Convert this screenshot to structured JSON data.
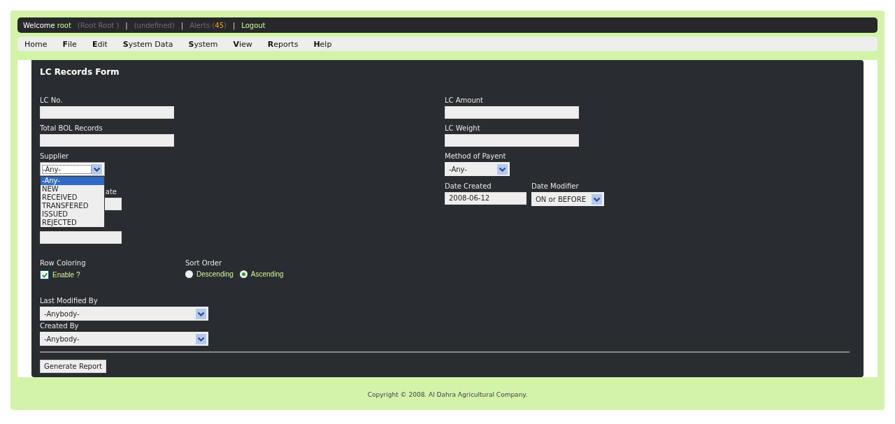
{
  "top_bar": [
    {
      "kind": "plain",
      "text": "Welcome"
    },
    {
      "kind": "user",
      "text": "root"
    },
    {
      "kind": "muted",
      "text": "(Root Root )"
    },
    {
      "kind": "sep",
      "text": "|"
    },
    {
      "kind": "muted",
      "text": "(undefined)"
    },
    {
      "kind": "sep",
      "text": "|"
    },
    {
      "kind": "alerts",
      "label": "Alerts (",
      "count": "45",
      "close": ")"
    },
    {
      "kind": "sep",
      "text": "|"
    },
    {
      "kind": "link",
      "text": "Logout"
    }
  ],
  "menu": [
    "Home",
    "**F**ile",
    "**E**dit",
    "**S**ystem Data",
    "**S**ystem",
    "**V**iew",
    "**R**eports",
    "**H**elp"
  ],
  "form": {
    "title": "LC Records Form",
    "left": [
      {
        "kind": "text",
        "label": "LC No."
      },
      {
        "kind": "text",
        "label": "Total BOL Records"
      },
      {
        "kind": "select",
        "label": "Supplier",
        "value": "-Any-",
        "focused": true,
        "open": true,
        "options": [
          {
            "text": "-Any-",
            "selected": true
          },
          {
            "text": "NEW",
            "selected": false
          },
          {
            "text": "RECEIVED",
            "selected": false
          },
          {
            "text": "TRANSFERED",
            "selected": false
          },
          {
            "text": "ISSUED",
            "selected": false
          },
          {
            "text": "REJECTED",
            "selected": false
          }
        ]
      },
      {
        "kind": "covered",
        "label": "ate"
      },
      {
        "kind": "covered"
      }
    ],
    "right": [
      {
        "kind": "text",
        "label": "LC Amount"
      },
      {
        "kind": "text",
        "label": "LC Weight"
      },
      {
        "kind": "select",
        "label": "Method of Payent",
        "value": "-Any-",
        "focused": false
      },
      {
        "kind": "pair",
        "items": [
          {
            "kind": "text",
            "label": "Date Created",
            "value": "2008-06-12"
          },
          {
            "kind": "select",
            "label": "Date Modifier",
            "value": "ON or BEFORE",
            "focused": false
          }
        ]
      }
    ],
    "row_coloring": {
      "label": "Row Coloring",
      "option": "Enable ?",
      "checked": true
    },
    "sort_order": {
      "label": "Sort Order",
      "options": [
        {
          "text": "Descending",
          "selected": false
        },
        {
          "text": "Ascending",
          "selected": true
        }
      ]
    },
    "people": [
      {
        "label": "Last Modified By",
        "value": "-Anybody-"
      },
      {
        "label": "Created By",
        "value": "-Anybody-"
      }
    ],
    "button": "Generate Report"
  },
  "footer": "Copyright © 2008. Al Dahra Agricultural Company."
}
